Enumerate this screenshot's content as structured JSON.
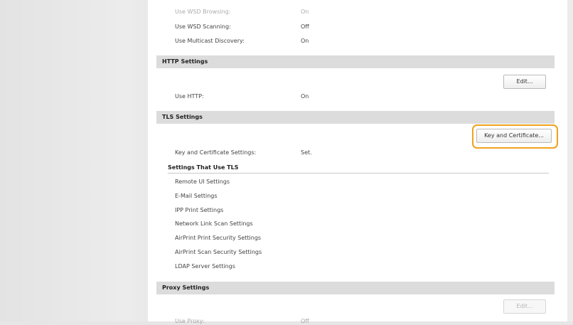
{
  "wsd": {
    "rows": [
      {
        "label": "Use WSD Browsing:",
        "value": "On"
      },
      {
        "label": "Use WSD Scanning:",
        "value": "Off"
      },
      {
        "label": "Use Multicast Discovery:",
        "value": "On"
      }
    ]
  },
  "http": {
    "header": "HTTP Settings",
    "edit_label": "Edit...",
    "rows": [
      {
        "label": "Use HTTP:",
        "value": "On"
      }
    ]
  },
  "tls": {
    "header": "TLS Settings",
    "key_button_label": "Key and Certificate...",
    "key_settings_label": "Key and Certificate Settings:",
    "key_settings_value": "Set.",
    "subheader": "Settings That Use TLS",
    "items": [
      "Remote UI Settings",
      "E-Mail Settings",
      "IPP Print Settings",
      "Network Link Scan Settings",
      "AirPrint Print Security Settings",
      "AirPrint Scan Security Settings",
      "LDAP Server Settings"
    ]
  },
  "proxy": {
    "header": "Proxy Settings",
    "edit_label": "Edit...",
    "rows": [
      {
        "label": "Use Proxy:",
        "value": "Off"
      }
    ]
  },
  "colors": {
    "highlight": "#f0a21e",
    "section_header_bg": "#dcdcdc"
  }
}
